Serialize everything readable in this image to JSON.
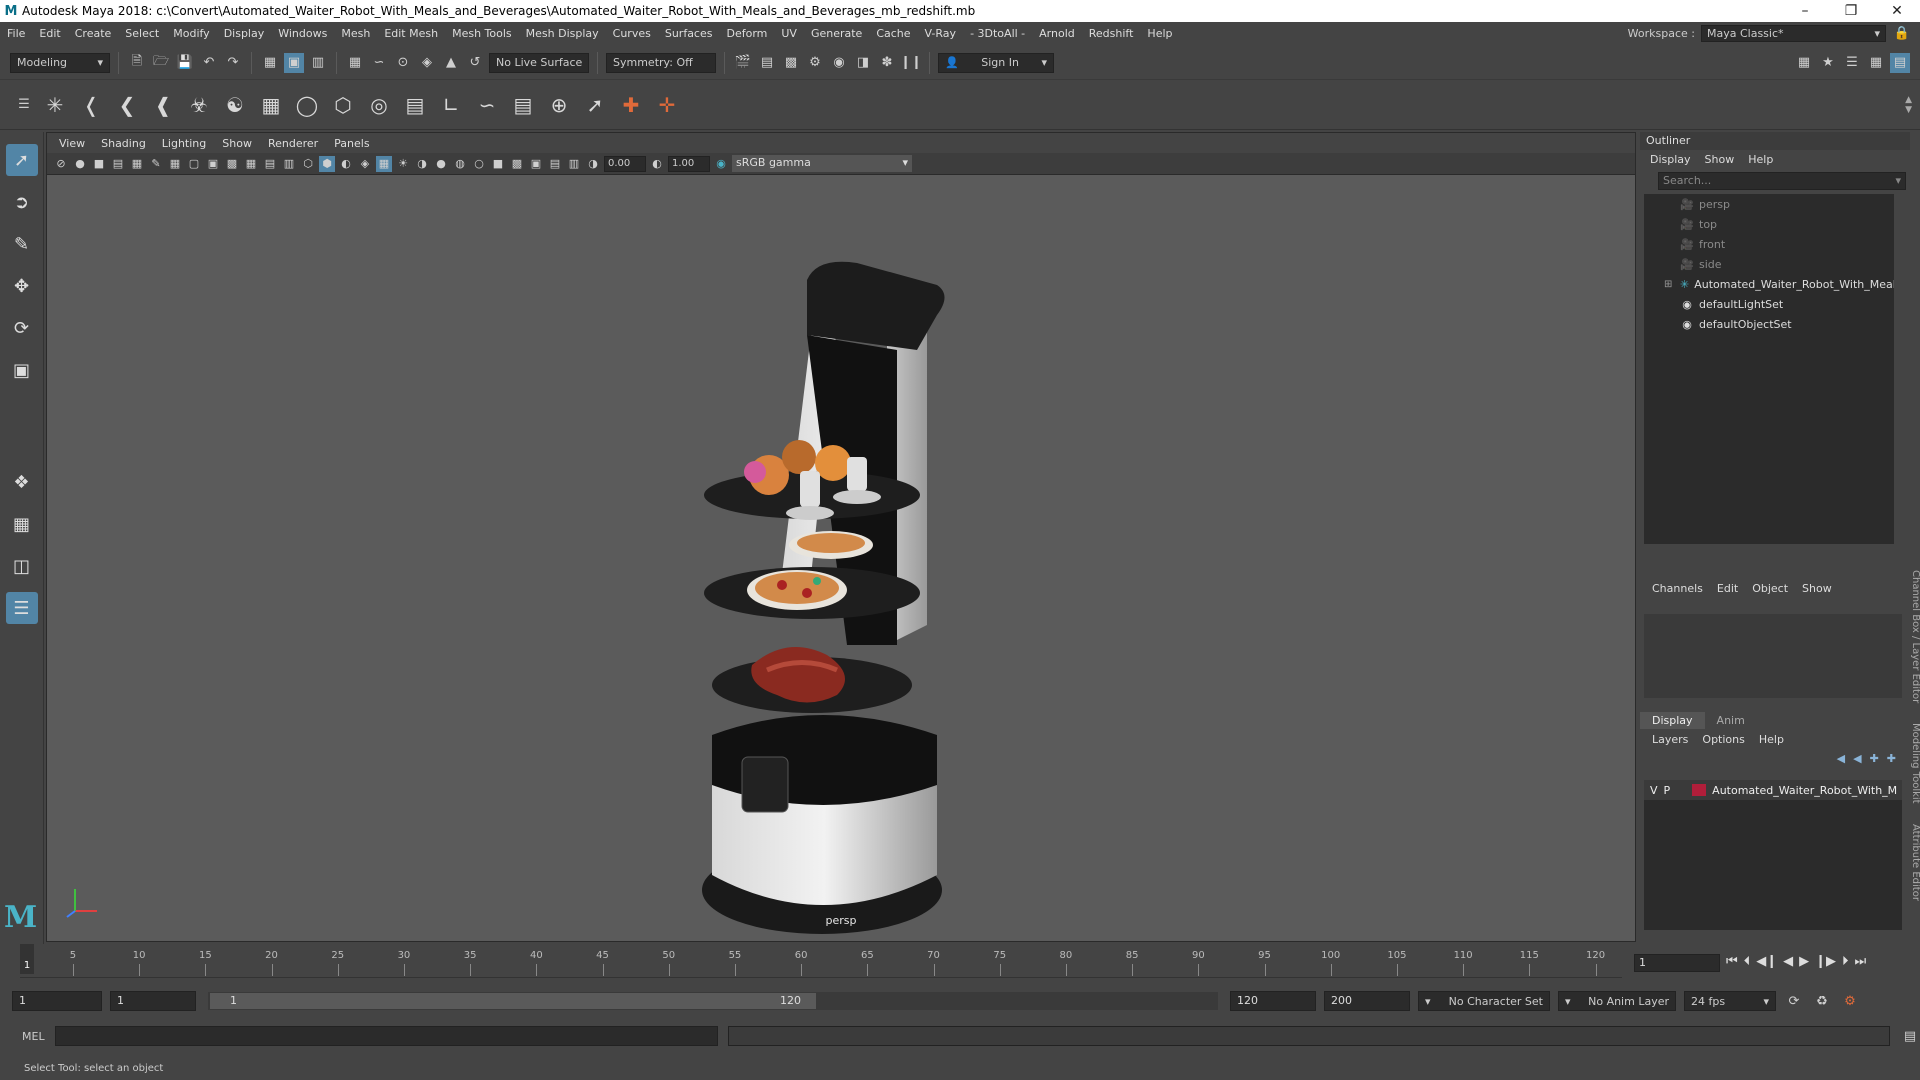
{
  "titlebar": {
    "title": "Autodesk Maya 2018: c:\\Convert\\Automated_Waiter_Robot_With_Meals_and_Beverages\\Automated_Waiter_Robot_With_Meals_and_Beverages_mb_redshift.mb",
    "logo": "M"
  },
  "menubar": {
    "items": [
      "File",
      "Edit",
      "Create",
      "Select",
      "Modify",
      "Display",
      "Windows",
      "Mesh",
      "Edit Mesh",
      "Mesh Tools",
      "Mesh Display",
      "Curves",
      "Surfaces",
      "Deform",
      "UV",
      "Generate",
      "Cache",
      "V-Ray",
      "- 3DtoAll -",
      "Arnold",
      "Redshift",
      "Help"
    ],
    "workspace_label": "Workspace :",
    "workspace_value": "Maya Classic*"
  },
  "statusline": {
    "mode": "Modeling",
    "live_surface": "No Live Surface",
    "symmetry": "Symmetry: Off",
    "sign_in": "Sign In"
  },
  "viewport": {
    "menu": [
      "View",
      "Shading",
      "Lighting",
      "Show",
      "Renderer",
      "Panels"
    ],
    "exposure": "0.00",
    "gamma_value": "1.00",
    "color_space": "sRGB gamma",
    "camera": "persp"
  },
  "outliner": {
    "title": "Outliner",
    "menu": [
      "Display",
      "Show",
      "Help"
    ],
    "search_placeholder": "Search...",
    "nodes": [
      {
        "label": "persp",
        "kind": "camera"
      },
      {
        "label": "top",
        "kind": "camera"
      },
      {
        "label": "front",
        "kind": "camera"
      },
      {
        "label": "side",
        "kind": "camera"
      },
      {
        "label": "Automated_Waiter_Robot_With_Meals_a",
        "kind": "group"
      },
      {
        "label": "defaultLightSet",
        "kind": "set"
      },
      {
        "label": "defaultObjectSet",
        "kind": "set"
      }
    ]
  },
  "channelbox": {
    "menu": [
      "Channels",
      "Edit",
      "Object",
      "Show"
    ]
  },
  "layereditor": {
    "tabs": [
      "Display",
      "Anim"
    ],
    "menu": [
      "Layers",
      "Options",
      "Help"
    ],
    "layer": {
      "v": "V",
      "p": "P",
      "name": "Automated_Waiter_Robot_With_M",
      "color": "#b01e3a"
    }
  },
  "sidetabs": [
    "Channel Box / Layer Editor",
    "Modeling Toolkit",
    "Attribute Editor"
  ],
  "timeslider": {
    "ticks": [
      5,
      10,
      15,
      20,
      25,
      30,
      35,
      40,
      45,
      50,
      55,
      60,
      65,
      70,
      75,
      80,
      85,
      90,
      95,
      100,
      105,
      110,
      115,
      120
    ],
    "current_frame": "1",
    "frame_field": "1"
  },
  "rangeslider": {
    "start": "1",
    "start_inner": "1",
    "range_left": "1",
    "range_right": "120",
    "end_inner": "120",
    "end": "200",
    "character_set": "No Character Set",
    "anim_layer": "No Anim Layer",
    "fps": "24 fps"
  },
  "cmdline": {
    "label": "MEL"
  },
  "helpline": {
    "text": "Select Tool: select an object"
  }
}
